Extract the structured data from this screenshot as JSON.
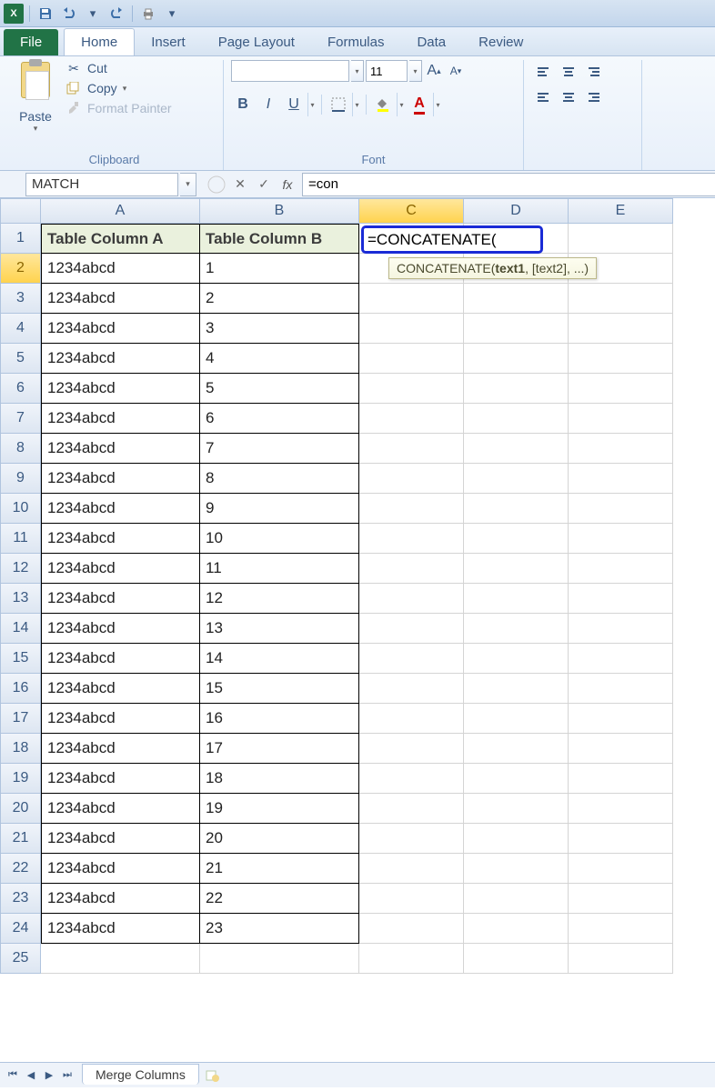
{
  "qat": {
    "save_title": "Save",
    "undo_title": "Undo",
    "redo_title": "Redo"
  },
  "tabs": {
    "file": "File",
    "items": [
      "Home",
      "Insert",
      "Page Layout",
      "Formulas",
      "Data",
      "Review"
    ],
    "active": "Home"
  },
  "ribbon": {
    "clipboard": {
      "label": "Clipboard",
      "paste": "Paste",
      "cut": "Cut",
      "copy": "Copy",
      "format_painter": "Format Painter"
    },
    "font": {
      "label": "Font",
      "name": "",
      "size": "11",
      "bold": "B",
      "italic": "I",
      "underline": "U",
      "grow": "A",
      "shrink": "A"
    }
  },
  "namebox": "MATCH",
  "fx_label": "fx",
  "formula_bar": "=con",
  "columns": [
    "A",
    "B",
    "C",
    "D",
    "E"
  ],
  "active_col": "C",
  "active_row": 2,
  "headers": {
    "A": "Table Column A",
    "B": "Table Column B"
  },
  "rows": [
    {
      "n": 1
    },
    {
      "n": 2,
      "A": "1234abcd",
      "B": "1"
    },
    {
      "n": 3,
      "A": "1234abcd",
      "B": "2"
    },
    {
      "n": 4,
      "A": "1234abcd",
      "B": "3"
    },
    {
      "n": 5,
      "A": "1234abcd",
      "B": "4"
    },
    {
      "n": 6,
      "A": "1234abcd",
      "B": "5"
    },
    {
      "n": 7,
      "A": "1234abcd",
      "B": "6"
    },
    {
      "n": 8,
      "A": "1234abcd",
      "B": "7"
    },
    {
      "n": 9,
      "A": "1234abcd",
      "B": "8"
    },
    {
      "n": 10,
      "A": "1234abcd",
      "B": "9"
    },
    {
      "n": 11,
      "A": "1234abcd",
      "B": "10"
    },
    {
      "n": 12,
      "A": "1234abcd",
      "B": "11"
    },
    {
      "n": 13,
      "A": "1234abcd",
      "B": "12"
    },
    {
      "n": 14,
      "A": "1234abcd",
      "B": "13"
    },
    {
      "n": 15,
      "A": "1234abcd",
      "B": "14"
    },
    {
      "n": 16,
      "A": "1234abcd",
      "B": "15"
    },
    {
      "n": 17,
      "A": "1234abcd",
      "B": "16"
    },
    {
      "n": 18,
      "A": "1234abcd",
      "B": "17"
    },
    {
      "n": 19,
      "A": "1234abcd",
      "B": "18"
    },
    {
      "n": 20,
      "A": "1234abcd",
      "B": "19"
    },
    {
      "n": 21,
      "A": "1234abcd",
      "B": "20"
    },
    {
      "n": 22,
      "A": "1234abcd",
      "B": "21"
    },
    {
      "n": 23,
      "A": "1234abcd",
      "B": "22"
    },
    {
      "n": 24,
      "A": "1234abcd",
      "B": "23"
    },
    {
      "n": 25
    }
  ],
  "editing": {
    "cell_text": "=CONCATENATE(",
    "tooltip_fn": "CONCATENATE(",
    "tooltip_arg1": "text1",
    "tooltip_rest": ", [text2], ...)"
  },
  "sheet_tab": "Merge Columns"
}
